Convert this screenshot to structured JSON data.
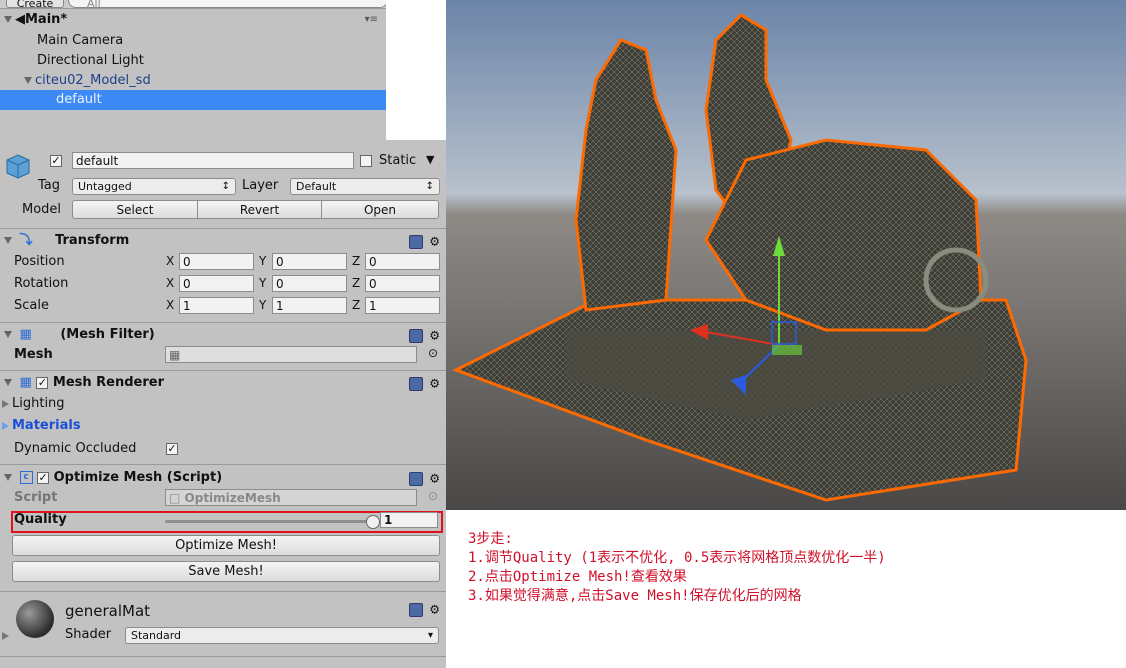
{
  "hierarchy": {
    "create_label": "Create",
    "search_placeholder": "All",
    "scene_name": "Main*",
    "items": [
      {
        "label": "Main Camera"
      },
      {
        "label": "Directional Light"
      },
      {
        "label": "citeu02_Model_sd"
      },
      {
        "label": "default"
      }
    ]
  },
  "inspector": {
    "object_name": "default",
    "static_label": "Static",
    "tag_label": "Tag",
    "tag_value": "Untagged",
    "layer_label": "Layer",
    "layer_value": "Default",
    "model_label": "Model",
    "model_buttons": [
      "Select",
      "Revert",
      "Open"
    ],
    "transform": {
      "title": "Transform",
      "rows": [
        {
          "label": "Position",
          "x": "0",
          "y": "0",
          "z": "0"
        },
        {
          "label": "Rotation",
          "x": "0",
          "y": "0",
          "z": "0"
        },
        {
          "label": "Scale",
          "x": "1",
          "y": "1",
          "z": "1"
        }
      ],
      "axis": [
        "X",
        "Y",
        "Z"
      ]
    },
    "mesh_filter": {
      "title": "(Mesh Filter)",
      "mesh_label": "Mesh"
    },
    "mesh_renderer": {
      "title": "Mesh Renderer",
      "lighting_label": "Lighting",
      "materials_label": "Materials",
      "dynamic_label": "Dynamic Occluded"
    },
    "optimize": {
      "title": "Optimize Mesh (Script)",
      "script_label": "Script",
      "script_value": "OptimizeMesh",
      "quality_label": "Quality",
      "quality_value": "1",
      "quality_fraction": 1.0,
      "optimize_button": "Optimize Mesh!",
      "save_button": "Save Mesh!"
    },
    "material": {
      "name": "generalMat",
      "shader_label": "Shader",
      "shader_value": "Standard"
    }
  },
  "notes": {
    "title": "3步走:",
    "steps": [
      "1.调节Quality (1表示不优化, 0.5表示将网格顶点数优化一半)",
      "2.点击Optimize Mesh!查看效果",
      "3.如果觉得满意,点击Save Mesh!保存优化后的网格"
    ]
  },
  "colors": {
    "panel": "#c2c2c2",
    "selection": "#3d8af7",
    "highlight_box": "#e0101e",
    "outline": "#ff6a00",
    "note_text": "#d0102a"
  }
}
